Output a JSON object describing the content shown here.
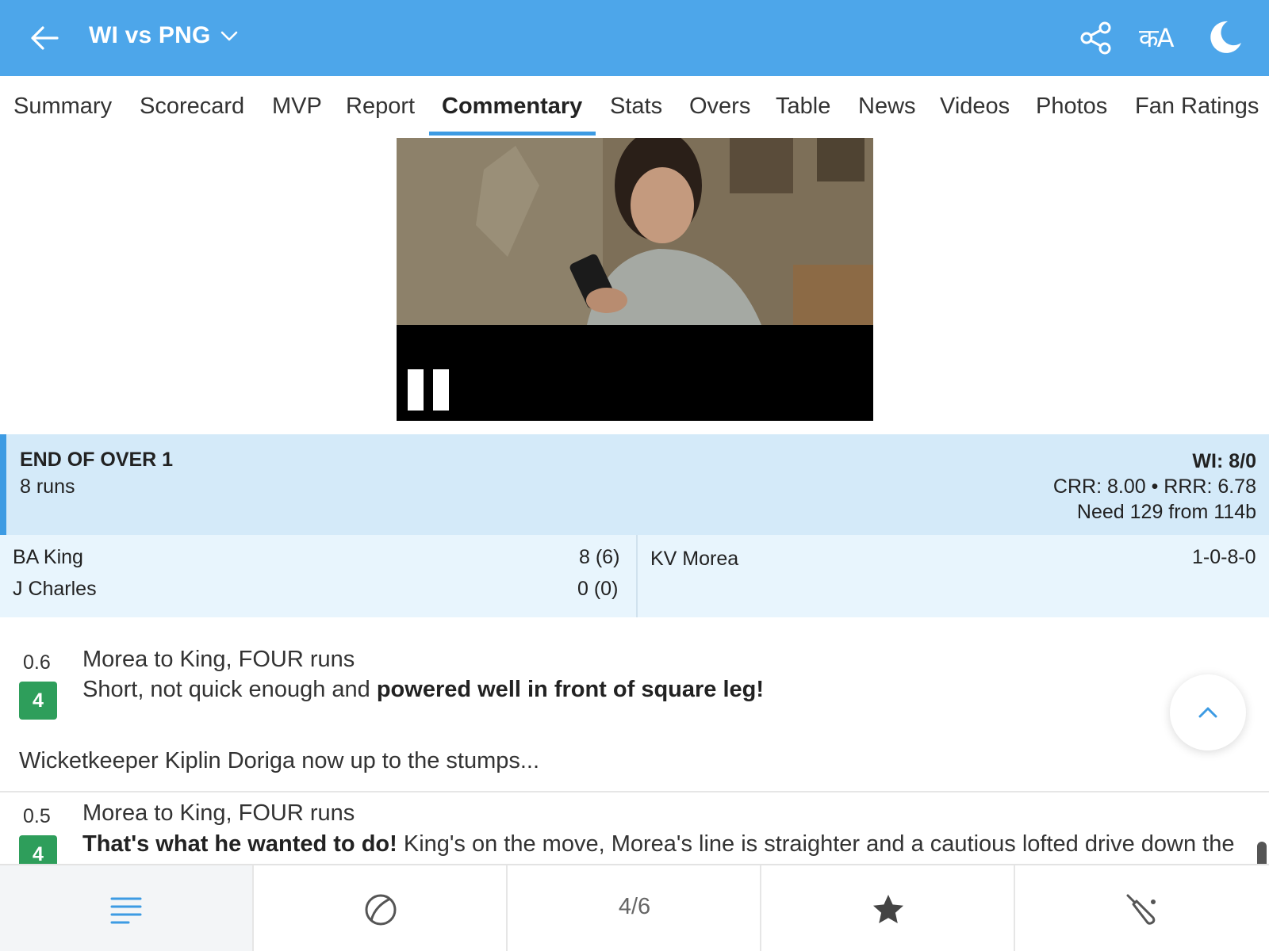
{
  "header": {
    "title": "WI vs PNG",
    "lang_label": "कA"
  },
  "tabs": [
    {
      "label": "Summary"
    },
    {
      "label": "Scorecard"
    },
    {
      "label": "MVP"
    },
    {
      "label": "Report"
    },
    {
      "label": "Commentary",
      "active": true
    },
    {
      "label": "Stats"
    },
    {
      "label": "Overs"
    },
    {
      "label": "Table"
    },
    {
      "label": "News"
    },
    {
      "label": "Videos"
    },
    {
      "label": "Photos"
    },
    {
      "label": "Fan Ratings"
    }
  ],
  "over_summary": {
    "heading": "END OF OVER 1",
    "runs": "8 runs",
    "score": "WI: 8/0",
    "rates": "CRR: 8.00 • RRR: 6.78",
    "need": "Need 129 from 114b"
  },
  "batters": [
    {
      "name": "BA King",
      "score": "8 (6)"
    },
    {
      "name": "J Charles",
      "score": "0 (0)"
    }
  ],
  "bowler": {
    "name": "KV Morea",
    "figures": "1-0-8-0"
  },
  "commentary": [
    {
      "ball": "0.6",
      "runs": "4",
      "title": "Morea to King, FOUR runs",
      "text_plain": "Short, not quick enough and ",
      "text_bold": "powered well in front of square leg!"
    },
    {
      "note": "Wicketkeeper Kiplin Doriga now up to the stumps..."
    },
    {
      "ball": "0.5",
      "runs": "4",
      "title": "Morea to King, FOUR runs",
      "text_bold": "That's what he wanted to do!",
      "text_plain": " King's on the move, Morea's line is straighter and a cautious lofted drive down the"
    }
  ],
  "bottom_nav": {
    "page_counter": "4/6",
    "items": [
      "menu-icon",
      "ball-icon",
      "page-counter",
      "star-icon",
      "bat-icon"
    ]
  },
  "colors": {
    "header_bg": "#4da6ea",
    "accent": "#3d9be3",
    "over_bg": "#d4eaf9",
    "batting_bg": "#e8f5fd",
    "boundary_badge": "#2e9e5b"
  }
}
